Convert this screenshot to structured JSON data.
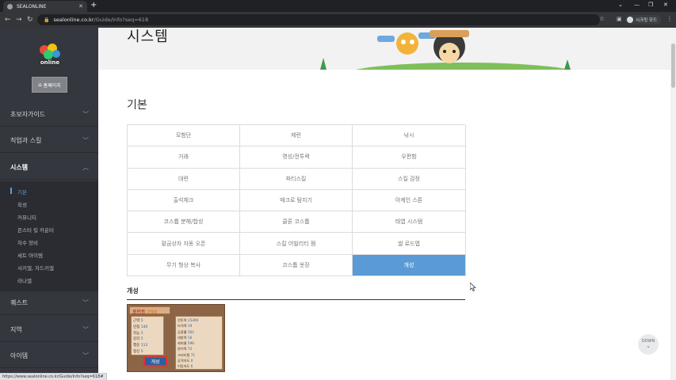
{
  "browser": {
    "tab_title": "SEALONLINE",
    "url_host": "sealonline.co.kr",
    "url_path": "/Guide/Info?seq=618",
    "profile_label": "시크릿 모드",
    "status_url": "https://www.sealonline.co.kr/Guide/Info?seq=618#"
  },
  "sidebar": {
    "logo_text": "online",
    "home_label": "홈페이지",
    "items": [
      {
        "label": "초보자가이드"
      },
      {
        "label": "직업과 스킬"
      },
      {
        "label": "시스템"
      },
      {
        "label": "퀘스트"
      },
      {
        "label": "지역"
      },
      {
        "label": "아이템"
      }
    ],
    "sub_items": [
      "기본",
      "육성",
      "커뮤니티",
      "몬스터 킬 카운터",
      "차수 장비",
      "세트 아이템",
      "사키엘, 자드키엘",
      "라나엘"
    ]
  },
  "banner": {
    "title": "시스템"
  },
  "main": {
    "section_title": "기본",
    "grid": [
      "모험단",
      "제련",
      "낚시",
      "거래",
      "명성/전투력",
      "우편함",
      "대련",
      "파티스킬",
      "스킬 감정",
      "출석체크",
      "매크로 탐지기",
      "아케인 스톤",
      "코스튬 분해/합성",
      "클론 코스튬",
      "태엽 시스템",
      "황금상자 자동 오픈",
      "스킬 어빌리티 젬",
      "씰 로드맵",
      "무기 형상 복사",
      "코스튬 옷장",
      "개성"
    ],
    "selected": "개성",
    "detail_title": "개성"
  },
  "game_shot": {
    "points_label": "포인트",
    "points_value": "755",
    "btn_label": "개성",
    "stats_left": [
      "근력",
      "민첩",
      "지능",
      "감각",
      "행운",
      "정신"
    ],
    "stats_left_vals": [
      "5",
      "140",
      "5",
      "5",
      "113",
      "5"
    ],
    "stats_right": [
      "전투력",
      "타격력",
      "공중률",
      "대방력",
      "회피율",
      "방어력",
      "크리티컬",
      "공격속도",
      "이동속도"
    ],
    "stats_right_vals": [
      "15300",
      "19",
      "562",
      "16",
      "596",
      "72",
      "71",
      "0",
      "6"
    ]
  },
  "down_label": "DOWN"
}
